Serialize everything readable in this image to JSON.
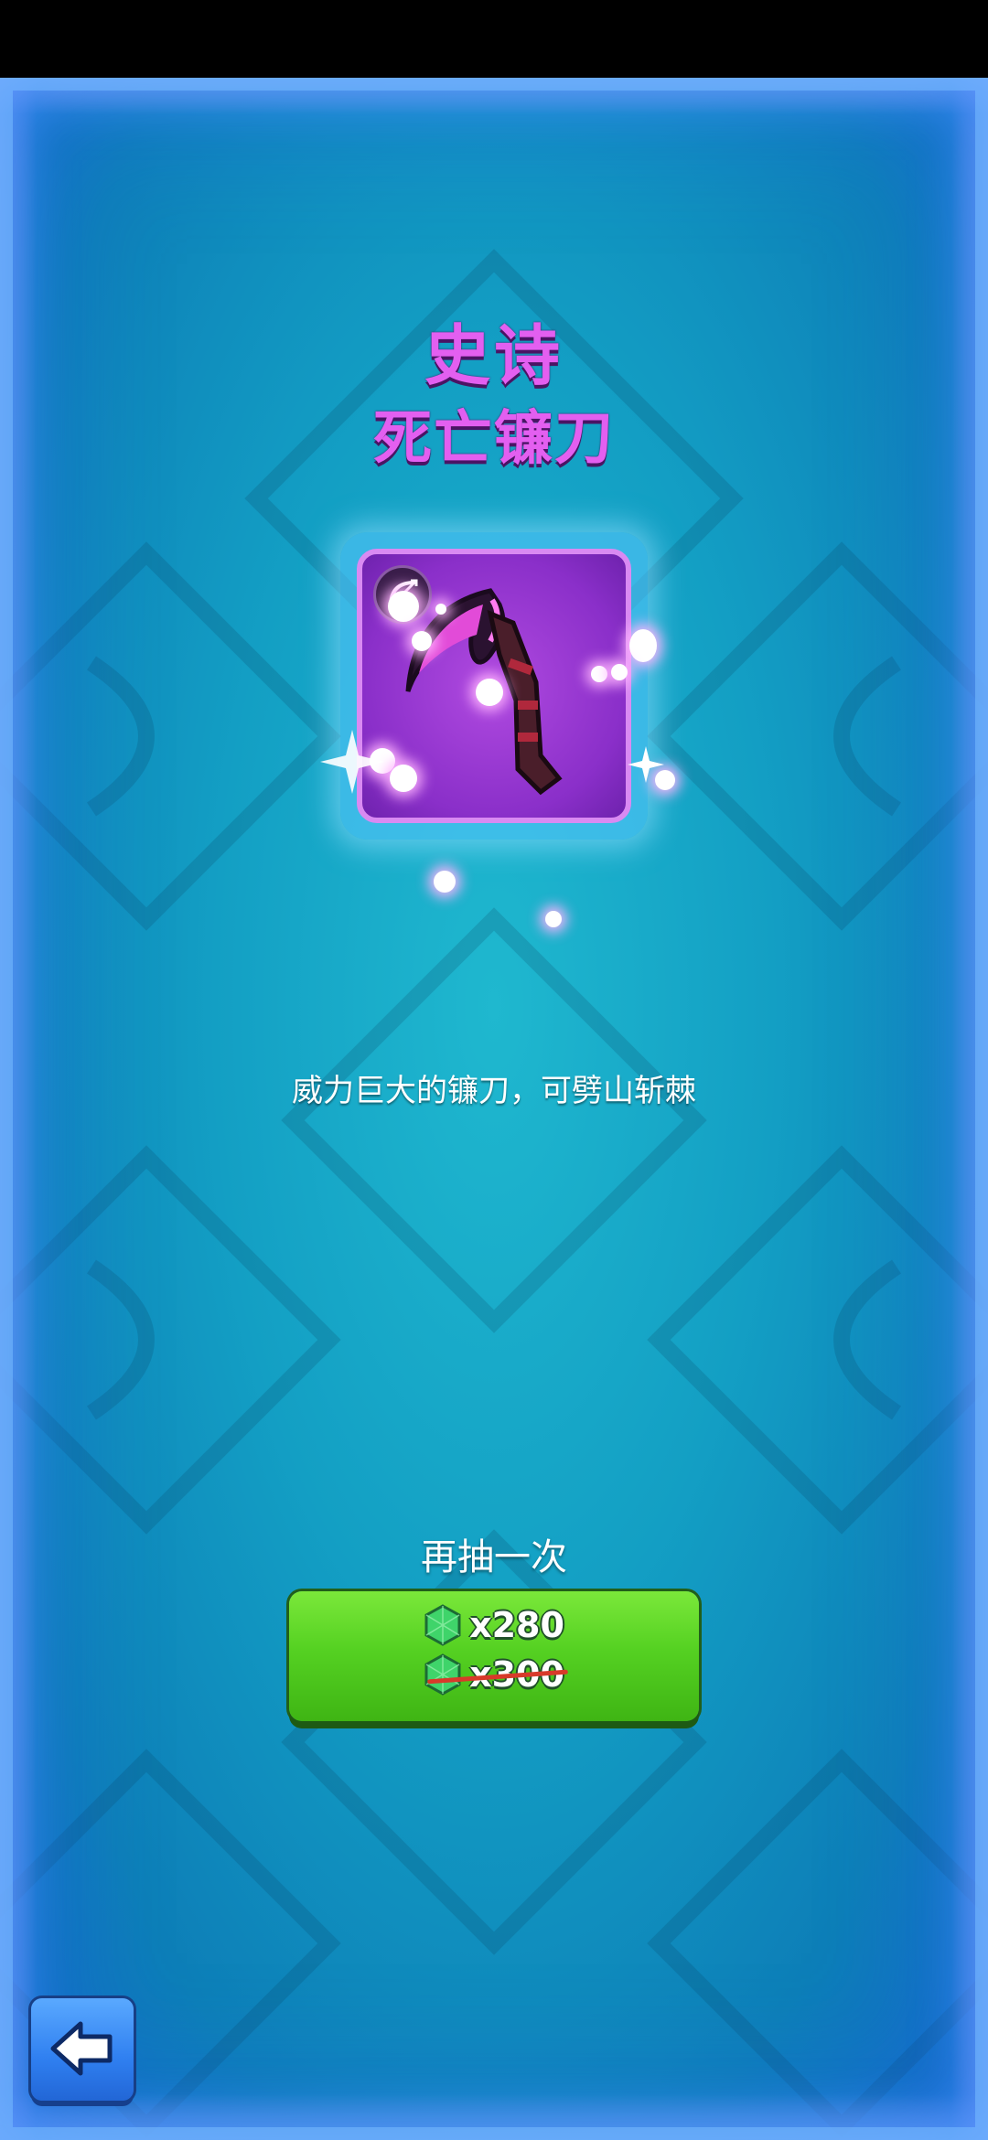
{
  "result": {
    "rarity": "史诗",
    "item_name": "死亡镰刀",
    "description": "威力巨大的镰刀，可劈山斩棘",
    "item_icon": "scythe-weapon-icon",
    "class_icon": "bow-class-icon"
  },
  "retry": {
    "label": "再抽一次",
    "current_price": "x280",
    "original_price": "x300",
    "currency_icon": "green-gem-icon"
  },
  "navigation": {
    "back_icon": "back-arrow-icon"
  },
  "colors": {
    "rarity_text": "#e35ff0",
    "card_purple": "#8a2fc9",
    "button_green": "#55d122",
    "back_blue": "#2f7ff0",
    "strike_red": "#d83a2a"
  }
}
